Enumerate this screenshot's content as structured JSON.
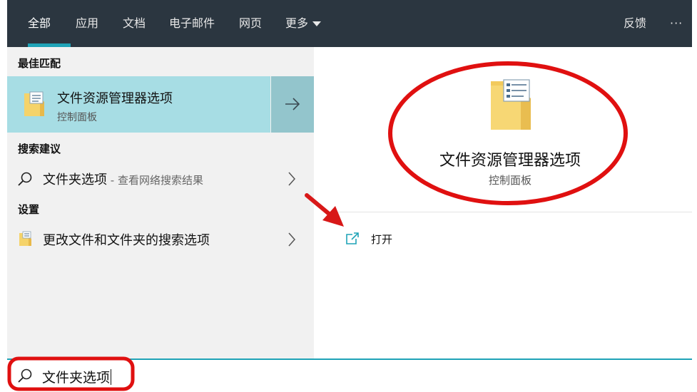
{
  "tabs": [
    {
      "label": "全部",
      "active": true
    },
    {
      "label": "应用"
    },
    {
      "label": "文档"
    },
    {
      "label": "电子邮件"
    },
    {
      "label": "网页"
    },
    {
      "label": "更多"
    }
  ],
  "header_right": {
    "feedback": "反馈",
    "more_options": "···"
  },
  "sections": {
    "best_match": "最佳匹配",
    "search_suggestions": "搜索建议",
    "settings": "设置"
  },
  "best_match": {
    "title": "文件资源管理器选项",
    "subtitle": "控制面板",
    "icon": "folder-options-icon"
  },
  "suggestion": {
    "text": "文件夹选项",
    "hint": " - 查看网络搜索结果",
    "icon": "search-icon"
  },
  "setting_item": {
    "text": "更改文件和文件夹的搜索选项",
    "icon": "folder-options-icon"
  },
  "detail": {
    "title": "文件资源管理器选项",
    "subtitle": "控制面板",
    "actions": [
      {
        "label": "打开",
        "icon": "open-external-icon"
      }
    ]
  },
  "search": {
    "query": "文件夹选项"
  },
  "colors": {
    "topbar": "#2b3640",
    "accent": "#1fa3b7",
    "selected_item": "#a7dde4",
    "annotation_red": "#e01010"
  }
}
